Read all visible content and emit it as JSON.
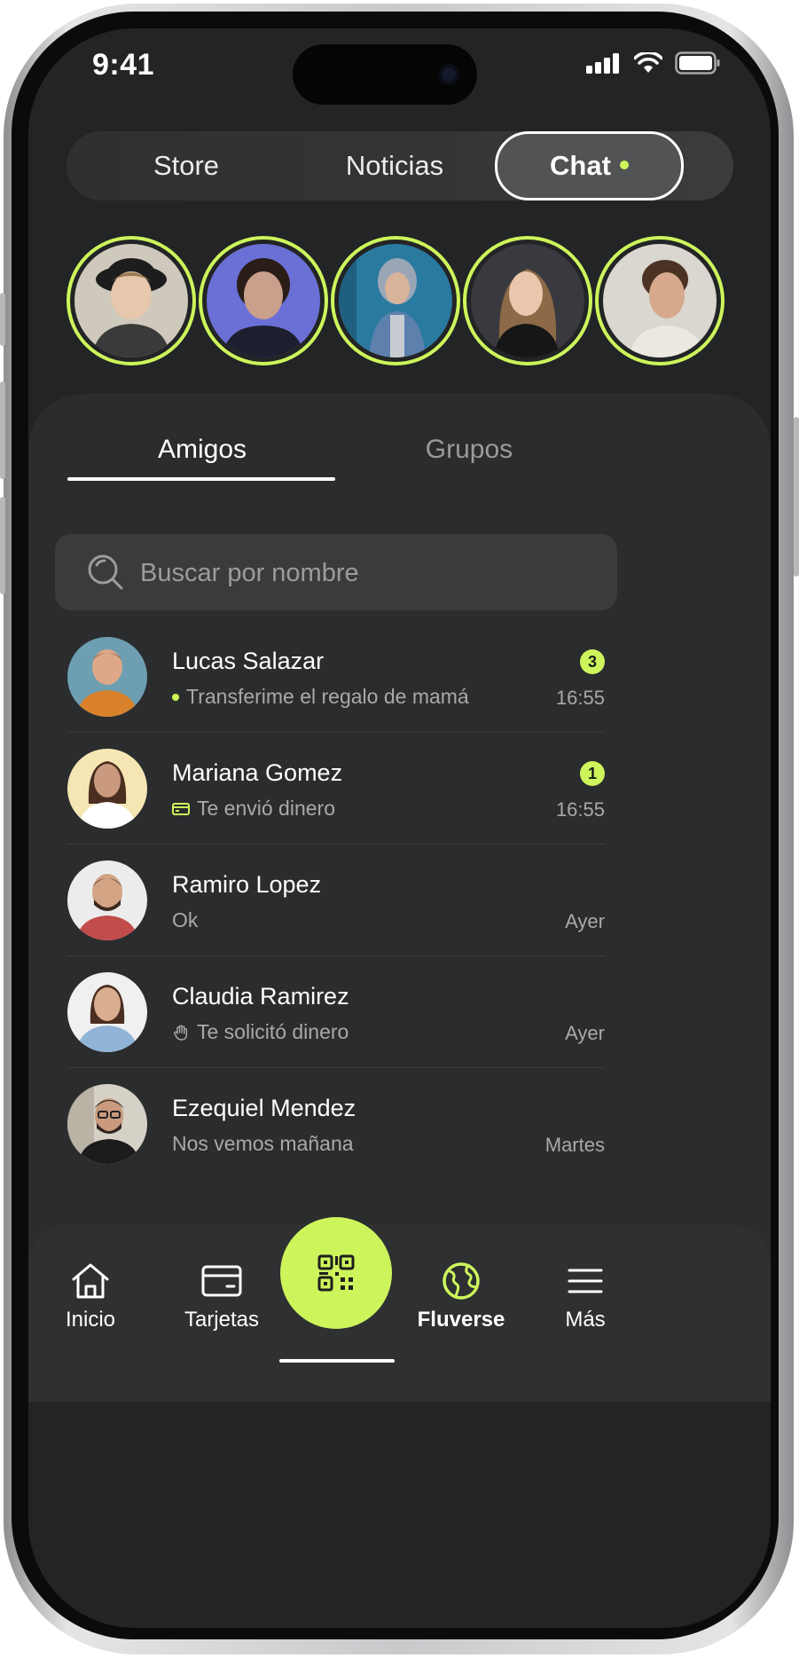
{
  "status_bar": {
    "time": "9:41"
  },
  "top_tabs": [
    {
      "label": "Store"
    },
    {
      "label": "Noticias"
    },
    {
      "label": "Chat",
      "active": true,
      "has_dot": true
    }
  ],
  "stories": [
    {
      "name": "story-1",
      "bg": "#c9c2b6",
      "hair": "#7a6a4f",
      "shirt": "#3a3a3a",
      "skin": "#e7c7ad"
    },
    {
      "name": "story-2",
      "bg": "#6e72d8",
      "hair": "#2a1d17",
      "shirt": "#1d1f2e",
      "skin": "#caa08a"
    },
    {
      "name": "story-3",
      "bg": "#2c7aa0",
      "hair": "#8a9ab0",
      "shirt": "#5a7aa8",
      "skin": "#d7b49a"
    },
    {
      "name": "story-4",
      "bg": "#3a3b40",
      "hair": "#8c6a48",
      "shirt": "#1a1a1a",
      "skin": "#e9c4aa"
    },
    {
      "name": "story-5",
      "bg": "#d8d7d0",
      "hair": "#4b3324",
      "shirt": "#e8e6df",
      "skin": "#d6a98c"
    }
  ],
  "sub_tabs": {
    "active": "Amigos",
    "inactive": "Grupos"
  },
  "search": {
    "placeholder": "Buscar por nombre"
  },
  "chats": [
    {
      "name": "Lucas Salazar",
      "message": "Transferime el regalo de mamá",
      "time": "16:55",
      "badge": "3",
      "icon": "unread-dot",
      "bg": "#6e9eb1",
      "shirt": "#d9822b",
      "skin": "#dca887",
      "hair": "#6d4b35"
    },
    {
      "name": "Mariana Gomez",
      "message": "Te envió dinero",
      "time": "16:55",
      "badge": "1",
      "icon": "card-icon",
      "bg": "#f7e8b8",
      "shirt": "#ffffff",
      "skin": "#c99a7e",
      "hair": "#4a2f20"
    },
    {
      "name": "Ramiro Lopez",
      "message": "Ok",
      "time": "Ayer",
      "badge": "",
      "icon": "",
      "bg": "#ebebeb",
      "shirt": "#c24b4b",
      "skin": "#d2a484",
      "hair": "#3b2a1e"
    },
    {
      "name": "Claudia Ramirez",
      "message": "Te solicitó dinero",
      "time": "Ayer",
      "badge": "",
      "icon": "hand-icon",
      "bg": "#f0f0f0",
      "shirt": "#8fb4d6",
      "skin": "#d9ad90",
      "hair": "#4a2e21"
    },
    {
      "name": "Ezequiel Mendez",
      "message": "Nos vemos mañana",
      "time": "Martes",
      "badge": "",
      "icon": "",
      "bg": "#d7d2c8",
      "shirt": "#1c1c1c",
      "skin": "#c99a7e",
      "hair": "#2e2520"
    }
  ],
  "bottom_nav": [
    {
      "label": "Inicio",
      "icon": "home-icon"
    },
    {
      "label": "Tarjetas",
      "icon": "card-icon"
    },
    {
      "label": "",
      "icon": "qr-icon"
    },
    {
      "label": "Fluverse",
      "icon": "globe-icon",
      "active": true
    },
    {
      "label": "Más",
      "icon": "menu-icon"
    }
  ],
  "colors": {
    "accent": "#cdf55b",
    "background": "#232426",
    "panel": "#2b2c2e"
  }
}
